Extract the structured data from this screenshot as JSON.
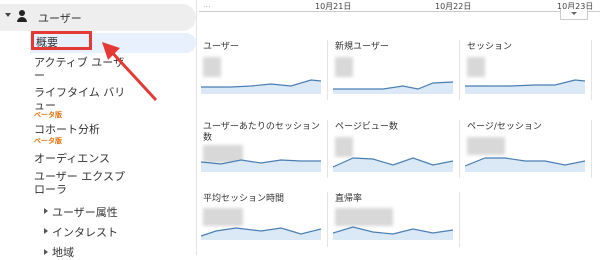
{
  "sidebar": {
    "section_title": "ユーザー",
    "items": [
      {
        "label": "概要"
      },
      {
        "label": "アクティブ ユーザ",
        "label_cont": "ー"
      },
      {
        "label": "ライフタイム バリ",
        "label_cont": "ュー",
        "badge": "ベータ版"
      },
      {
        "label": "コホート分析",
        "badge": "ベータ版"
      },
      {
        "label": "オーディエンス"
      },
      {
        "label": "ユーザー エクスプ",
        "label_cont": "ローラ"
      },
      {
        "label": "ユーザー属性"
      },
      {
        "label": "インタレスト"
      },
      {
        "label": "地域"
      }
    ]
  },
  "timeline": {
    "dots": "...",
    "labels": [
      "10月21日",
      "10月22日",
      "10月23日"
    ]
  },
  "cards": [
    {
      "title": "ユーザー"
    },
    {
      "title": "新規ユーザー"
    },
    {
      "title": "セッション"
    },
    {
      "title": "ユーザーあたりのセッション",
      "title_cont": "数"
    },
    {
      "title": "ページビュー数"
    },
    {
      "title": "ページ/セッション"
    },
    {
      "title": "平均セッション時間"
    },
    {
      "title": "直帰率"
    }
  ],
  "colors": {
    "accent_red": "#e53935",
    "active_bg": "#e8f0fe",
    "spark_line": "#4a7fb5",
    "spark_fill": "#dbe8f5",
    "beta_badge": "#e8710a"
  }
}
